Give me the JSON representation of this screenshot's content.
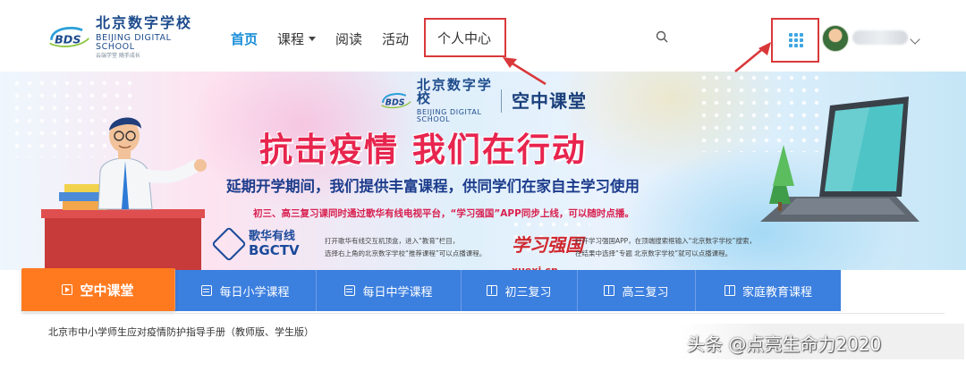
{
  "header": {
    "logo": {
      "abbr": "BDS",
      "name_cn": "北京数字学校",
      "name_en": "BEIJING DIGITAL SCHOOL",
      "tagline": "云端学堂  随手成长"
    },
    "nav": [
      {
        "label": "首页",
        "active": true
      },
      {
        "label": "课程",
        "dropdown": true
      },
      {
        "label": "阅读"
      },
      {
        "label": "活动"
      },
      {
        "label": "个人中心",
        "highlighted": true
      }
    ],
    "search_icon": "search-icon",
    "apps_icon": "grid-icon",
    "highlight_color": "#d9383a",
    "accent_color": "#1a8fd8"
  },
  "banner": {
    "logo_abbr": "BDS",
    "logo_cn": "北京数字学校",
    "logo_en": "BEIJING DIGITAL SCHOOL",
    "program": "空中课堂",
    "slogan": "抗击疫情    我们在行动",
    "subline": "延期开学期间，我们提供丰富课程，供同学们在家自主学习使用",
    "notice": "初三、高三复习课同时通过歌华有线电视平台，“学习强国”APP同步上线，可以随时点播。",
    "partner1": {
      "name_cn": "歌华有线",
      "name_en": "BGCTV",
      "desc_line1": "打开歌华有线交互机顶盒，进入“教育”栏目，",
      "desc_line2": "选择右上角的北京数字学校“推荐课程”可以点播课程。"
    },
    "partner2": {
      "name": "学习强国",
      "name_sub": "xuexi.cn",
      "desc_line1": "打开学习强国APP，在顶端搜索框输入“北京数字学校”搜索，",
      "desc_line2": "在结果中选择“专题 北京数字学校”就可以点播课程。"
    }
  },
  "tabs": [
    {
      "label": "空中课堂",
      "icon": "play-icon",
      "active": true
    },
    {
      "label": "每日小学课程",
      "icon": "calendar-icon"
    },
    {
      "label": "每日中学课程",
      "icon": "calendar-icon"
    },
    {
      "label": "初三复习",
      "icon": "book-icon"
    },
    {
      "label": "高三复习",
      "icon": "book-icon"
    },
    {
      "label": "家庭教育课程",
      "icon": "book-icon"
    }
  ],
  "colors": {
    "tab_bar": "#3b7fdf",
    "tab_active": "#ff7a1f",
    "slogan": "#e7254e"
  },
  "doc_link": "北京市中小学师生应对疫情防护指导手册（教师版、学生版）",
  "watermark": "头条 @点亮生命力2020"
}
